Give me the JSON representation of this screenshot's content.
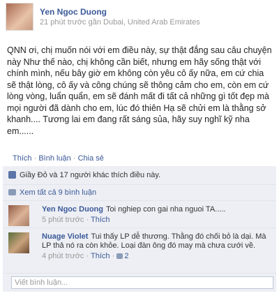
{
  "post": {
    "author": "Yen Ngoc Duong",
    "timestamp": "21 phút trước gần Dubai, United Arab Emirates",
    "content": "QNN ơi, chị muốn nói với em điều này, sự thật đắng sau câu chuyện này Như thế nào, chị không cần biết, nhưng em hãy sống thật với chính mình, nếu bây giờ em không còn yêu cô ấy nữa, em cứ chia sẽ thật lòng, cô ấy và công chúng sẽ thông cảm cho em, còn em cứ lòng vòng, luẩn quẩn, em sẽ đánh mất đi tất cả những gì tốt đẹp mà mọi người đã dành cho em, lúc đó thiên Hạ sẽ chửi em là thằng sở khanh.... Tương lai em đang rất sáng sủa, hãy suy nghĩ kỹ nha em......"
  },
  "actions": {
    "like": "Thích",
    "comment": "Bình luận",
    "share": "Chia sẻ",
    "sep": "·"
  },
  "feedback": {
    "likes_text": "Giầy Đỏ và 17 người khác thích điều này.",
    "view_all": "Xem tất cả 9 bình luận"
  },
  "comments": [
    {
      "author": "Yen Ngoc Duong",
      "text": "Toi nghiep con gai nha nguoi TA.....",
      "time": "5 phút trước",
      "like": "Thích",
      "sep": "·"
    },
    {
      "author": "Nuage Violet",
      "text": "Tui thấy LP dễ thương. Thằng đó chối bỏ là dại. Mà LP thả nó ra còn khỏe. Loại đàn ông đó may mà chưa cưới về.",
      "time": "4 phút trước",
      "like": "Thích",
      "sep": "·",
      "replies": "2"
    }
  ],
  "write_comment": {
    "placeholder": "Viết bình luận..."
  }
}
